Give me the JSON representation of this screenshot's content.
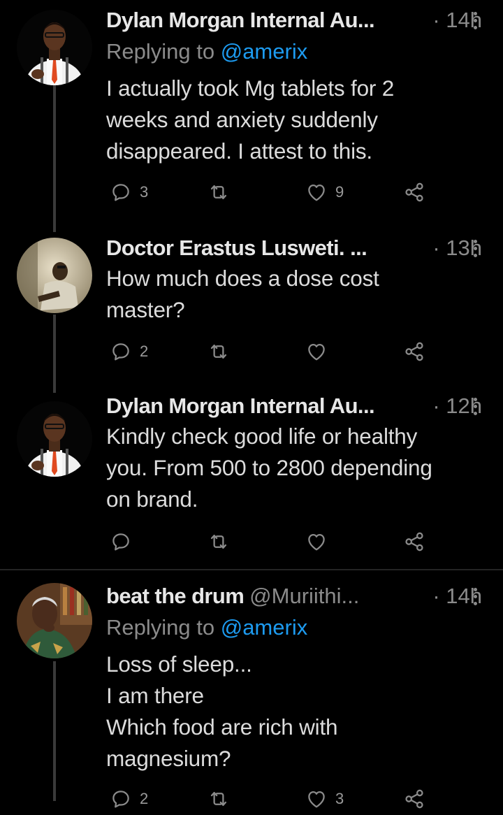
{
  "tweets": [
    {
      "name": "Dylan Morgan Internal Au...",
      "handle": "",
      "time": "· 14h",
      "replying_label": "Replying to",
      "replying_handle": "@amerix",
      "text": "I actually took Mg tablets for 2\nweeks and anxiety suddenly\ndisappeared. I attest to this.",
      "reply_count": "3",
      "retweet_count": "",
      "like_count": "9"
    },
    {
      "name": "Doctor Erastus Lusweti. ...",
      "handle": "",
      "time": "· 13h",
      "text": "How much does a dose cost\nmaster?",
      "reply_count": "2",
      "retweet_count": "",
      "like_count": ""
    },
    {
      "name": "Dylan Morgan Internal Au...",
      "handle": "",
      "time": "· 12h",
      "text": "Kindly check good life or healthy\nyou. From 500 to 2800 depending\non brand.",
      "reply_count": "",
      "retweet_count": "",
      "like_count": ""
    },
    {
      "name": "beat the drum",
      "handle": "@Muriithi...",
      "time": "· 14h",
      "replying_label": "Replying to",
      "replying_handle": "@amerix",
      "text": "Loss of sleep...\nI am there\nWhich food are rich with\nmagnesium?",
      "reply_count": "2",
      "retweet_count": "",
      "like_count": "3"
    }
  ],
  "icons": {
    "reply": "reply-icon",
    "retweet": "retweet-icon",
    "like": "heart-icon",
    "share": "share-icon",
    "more": "more-vertical-icon"
  },
  "colors": {
    "background": "#000000",
    "link": "#1d9bf0",
    "muted": "#8b8b8b"
  }
}
